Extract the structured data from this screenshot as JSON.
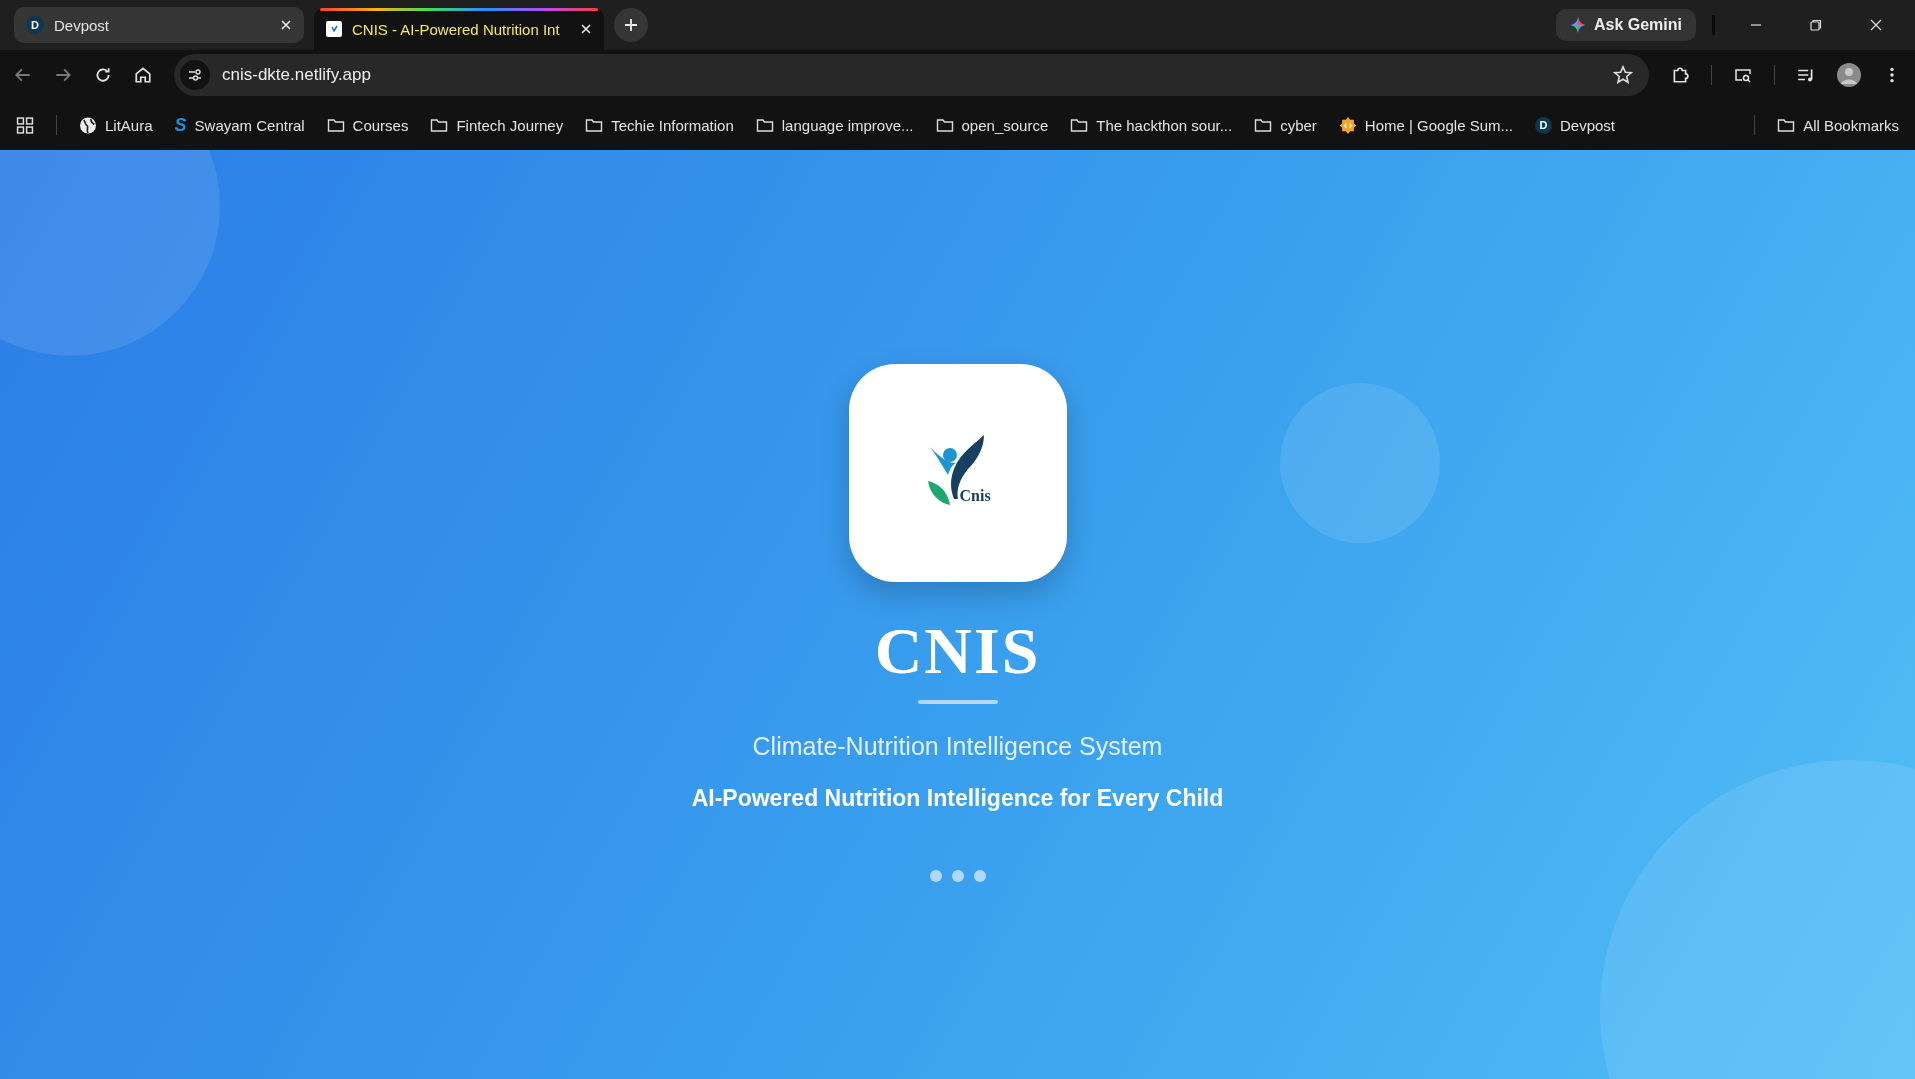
{
  "tabs": [
    {
      "title": "Devpost",
      "favicon_letter": "D",
      "selected": false
    },
    {
      "title": "CNIS - AI-Powered Nutrition Int",
      "selected": true
    }
  ],
  "gemini_button": "Ask Gemini",
  "address_bar": {
    "url": "cnis-dkte.netlify.app"
  },
  "bookmarks": [
    {
      "label": "LitAura",
      "kind": "globe"
    },
    {
      "label": "Swayam Central",
      "kind": "s-logo",
      "letter": "S"
    },
    {
      "label": "Courses",
      "kind": "folder"
    },
    {
      "label": "Fintech Journey",
      "kind": "folder"
    },
    {
      "label": "Techie Information",
      "kind": "folder"
    },
    {
      "label": "language improve...",
      "kind": "folder"
    },
    {
      "label": "open_source",
      "kind": "folder"
    },
    {
      "label": "The hackthon sour...",
      "kind": "folder"
    },
    {
      "label": "cyber",
      "kind": "folder"
    },
    {
      "label": "Home | Google Sum...",
      "kind": "badge"
    },
    {
      "label": "Devpost",
      "kind": "letter",
      "letter": "D"
    }
  ],
  "all_bookmarks": "All Bookmarks",
  "splash": {
    "logo_text": "Cnis",
    "title": "CNIS",
    "subtitle": "Climate-Nutrition Intelligence System",
    "tagline": "AI-Powered Nutrition Intelligence for Every Child"
  }
}
